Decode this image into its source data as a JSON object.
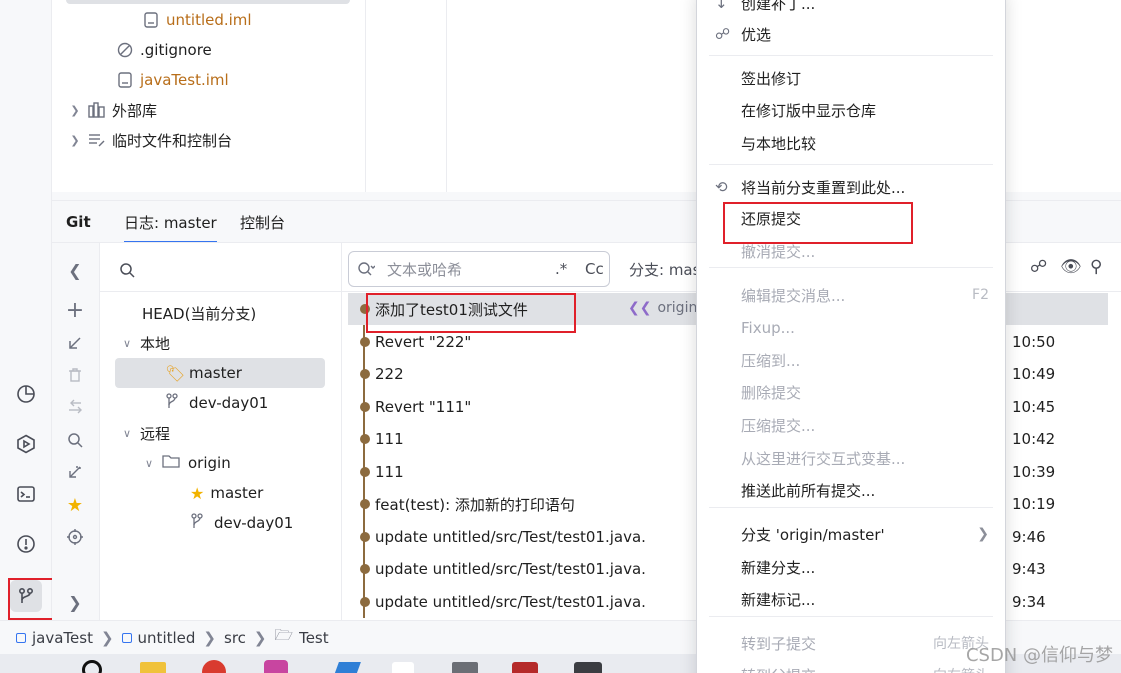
{
  "project_tree": {
    "items": [
      {
        "label": "untitled.iml",
        "icon": "iml-file-icon",
        "color": "#b86e1a"
      },
      {
        "label": ".gitignore",
        "icon": "ignored-file-icon",
        "color": "#1f1f1f"
      },
      {
        "label": "javaTest.iml",
        "icon": "iml-file-icon",
        "color": "#b86e1a"
      },
      {
        "label": "外部库",
        "icon": "library-icon",
        "color": "#1f1f1f"
      },
      {
        "label": "临时文件和控制台",
        "icon": "scratches-icon",
        "color": "#1f1f1f"
      }
    ]
  },
  "git_window": {
    "title": "Git",
    "tabs": [
      "日志: master",
      "控制台"
    ]
  },
  "branches": {
    "head": "HEAD(当前分支)",
    "local_label": "本地",
    "local": [
      "master",
      "dev-day01"
    ],
    "remote_label": "远程",
    "remote_folder": "origin",
    "remote": [
      "master",
      "dev-day01"
    ]
  },
  "log": {
    "search_placeholder": "文本或哈希",
    "regex_toggle": ".*",
    "case_toggle": "Cc",
    "branch_filter": "分支: mas",
    "selected_ref": "origin",
    "commits": [
      {
        "message": "添加了test01测试文件",
        "time": ""
      },
      {
        "message": "Revert \"222\"",
        "time": "10:50"
      },
      {
        "message": "222",
        "time": "10:49"
      },
      {
        "message": "Revert \"111\"",
        "time": "10:45"
      },
      {
        "message": "111",
        "time": "10:42"
      },
      {
        "message": "111",
        "time": "10:39"
      },
      {
        "message": "feat(test): 添加新的打印语句",
        "time": "10:19"
      },
      {
        "message": "update untitled/src/Test/test01.java.",
        "time": "9:46"
      },
      {
        "message": "update untitled/src/Test/test01.java.",
        "time": "9:43"
      },
      {
        "message": "update untitled/src/Test/test01.java.",
        "time": "9:34"
      }
    ]
  },
  "breadcrumb": [
    "javaTest",
    "untitled",
    "src",
    "Test"
  ],
  "context_menu": {
    "items": [
      {
        "label": "创建补丁...",
        "enabled": true,
        "shortcut": ""
      },
      {
        "label": "优选",
        "enabled": true,
        "shortcut": ""
      },
      {
        "label": "签出修订",
        "enabled": true,
        "shortcut": ""
      },
      {
        "label": "在修订版中显示仓库",
        "enabled": true,
        "shortcut": ""
      },
      {
        "label": "与本地比较",
        "enabled": true,
        "shortcut": ""
      },
      {
        "label": "将当前分支重置到此处...",
        "enabled": true,
        "shortcut": ""
      },
      {
        "label": "还原提交",
        "enabled": true,
        "shortcut": ""
      },
      {
        "label": "撤消提交...",
        "enabled": false,
        "shortcut": ""
      },
      {
        "label": "编辑提交消息...",
        "enabled": false,
        "shortcut": "F2"
      },
      {
        "label": "Fixup...",
        "enabled": false,
        "shortcut": ""
      },
      {
        "label": "压缩到...",
        "enabled": false,
        "shortcut": ""
      },
      {
        "label": "删除提交",
        "enabled": false,
        "shortcut": ""
      },
      {
        "label": "压缩提交...",
        "enabled": false,
        "shortcut": ""
      },
      {
        "label": "从这里进行交互式变基...",
        "enabled": false,
        "shortcut": ""
      },
      {
        "label": "推送此前所有提交...",
        "enabled": true,
        "shortcut": ""
      },
      {
        "label": "分支 'origin/master'",
        "enabled": true,
        "shortcut": ""
      },
      {
        "label": "新建分支...",
        "enabled": true,
        "shortcut": ""
      },
      {
        "label": "新建标记...",
        "enabled": true,
        "shortcut": ""
      },
      {
        "label": "转到子提交",
        "enabled": false,
        "shortcut": "向左箭头"
      },
      {
        "label": "转到父提交",
        "enabled": false,
        "shortcut": "向右箭头"
      }
    ]
  },
  "watermark": "CSDN @信仰与梦",
  "colors": {
    "accent": "#3574f0",
    "highlight": "#e0202a",
    "graph": "#8c6b3f"
  }
}
